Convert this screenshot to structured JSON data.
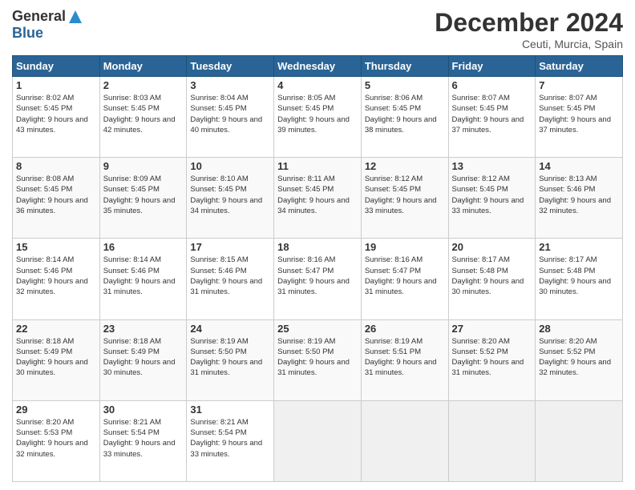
{
  "logo": {
    "general": "General",
    "blue": "Blue"
  },
  "title": "December 2024",
  "location": "Ceuti, Murcia, Spain",
  "days_of_week": [
    "Sunday",
    "Monday",
    "Tuesday",
    "Wednesday",
    "Thursday",
    "Friday",
    "Saturday"
  ],
  "weeks": [
    [
      {
        "day": "1",
        "sunrise": "8:02 AM",
        "sunset": "5:45 PM",
        "daylight": "9 hours and 43 minutes."
      },
      {
        "day": "2",
        "sunrise": "8:03 AM",
        "sunset": "5:45 PM",
        "daylight": "9 hours and 42 minutes."
      },
      {
        "day": "3",
        "sunrise": "8:04 AM",
        "sunset": "5:45 PM",
        "daylight": "9 hours and 40 minutes."
      },
      {
        "day": "4",
        "sunrise": "8:05 AM",
        "sunset": "5:45 PM",
        "daylight": "9 hours and 39 minutes."
      },
      {
        "day": "5",
        "sunrise": "8:06 AM",
        "sunset": "5:45 PM",
        "daylight": "9 hours and 38 minutes."
      },
      {
        "day": "6",
        "sunrise": "8:07 AM",
        "sunset": "5:45 PM",
        "daylight": "9 hours and 37 minutes."
      },
      {
        "day": "7",
        "sunrise": "8:07 AM",
        "sunset": "5:45 PM",
        "daylight": "9 hours and 37 minutes."
      }
    ],
    [
      {
        "day": "8",
        "sunrise": "8:08 AM",
        "sunset": "5:45 PM",
        "daylight": "9 hours and 36 minutes."
      },
      {
        "day": "9",
        "sunrise": "8:09 AM",
        "sunset": "5:45 PM",
        "daylight": "9 hours and 35 minutes."
      },
      {
        "day": "10",
        "sunrise": "8:10 AM",
        "sunset": "5:45 PM",
        "daylight": "9 hours and 34 minutes."
      },
      {
        "day": "11",
        "sunrise": "8:11 AM",
        "sunset": "5:45 PM",
        "daylight": "9 hours and 34 minutes."
      },
      {
        "day": "12",
        "sunrise": "8:12 AM",
        "sunset": "5:45 PM",
        "daylight": "9 hours and 33 minutes."
      },
      {
        "day": "13",
        "sunrise": "8:12 AM",
        "sunset": "5:45 PM",
        "daylight": "9 hours and 33 minutes."
      },
      {
        "day": "14",
        "sunrise": "8:13 AM",
        "sunset": "5:46 PM",
        "daylight": "9 hours and 32 minutes."
      }
    ],
    [
      {
        "day": "15",
        "sunrise": "8:14 AM",
        "sunset": "5:46 PM",
        "daylight": "9 hours and 32 minutes."
      },
      {
        "day": "16",
        "sunrise": "8:14 AM",
        "sunset": "5:46 PM",
        "daylight": "9 hours and 31 minutes."
      },
      {
        "day": "17",
        "sunrise": "8:15 AM",
        "sunset": "5:46 PM",
        "daylight": "9 hours and 31 minutes."
      },
      {
        "day": "18",
        "sunrise": "8:16 AM",
        "sunset": "5:47 PM",
        "daylight": "9 hours and 31 minutes."
      },
      {
        "day": "19",
        "sunrise": "8:16 AM",
        "sunset": "5:47 PM",
        "daylight": "9 hours and 31 minutes."
      },
      {
        "day": "20",
        "sunrise": "8:17 AM",
        "sunset": "5:48 PM",
        "daylight": "9 hours and 30 minutes."
      },
      {
        "day": "21",
        "sunrise": "8:17 AM",
        "sunset": "5:48 PM",
        "daylight": "9 hours and 30 minutes."
      }
    ],
    [
      {
        "day": "22",
        "sunrise": "8:18 AM",
        "sunset": "5:49 PM",
        "daylight": "9 hours and 30 minutes."
      },
      {
        "day": "23",
        "sunrise": "8:18 AM",
        "sunset": "5:49 PM",
        "daylight": "9 hours and 30 minutes."
      },
      {
        "day": "24",
        "sunrise": "8:19 AM",
        "sunset": "5:50 PM",
        "daylight": "9 hours and 31 minutes."
      },
      {
        "day": "25",
        "sunrise": "8:19 AM",
        "sunset": "5:50 PM",
        "daylight": "9 hours and 31 minutes."
      },
      {
        "day": "26",
        "sunrise": "8:19 AM",
        "sunset": "5:51 PM",
        "daylight": "9 hours and 31 minutes."
      },
      {
        "day": "27",
        "sunrise": "8:20 AM",
        "sunset": "5:52 PM",
        "daylight": "9 hours and 31 minutes."
      },
      {
        "day": "28",
        "sunrise": "8:20 AM",
        "sunset": "5:52 PM",
        "daylight": "9 hours and 32 minutes."
      }
    ],
    [
      {
        "day": "29",
        "sunrise": "8:20 AM",
        "sunset": "5:53 PM",
        "daylight": "9 hours and 32 minutes."
      },
      {
        "day": "30",
        "sunrise": "8:21 AM",
        "sunset": "5:54 PM",
        "daylight": "9 hours and 33 minutes."
      },
      {
        "day": "31",
        "sunrise": "8:21 AM",
        "sunset": "5:54 PM",
        "daylight": "9 hours and 33 minutes."
      },
      null,
      null,
      null,
      null
    ]
  ],
  "labels": {
    "sunrise": "Sunrise: ",
    "sunset": "Sunset: ",
    "daylight": "Daylight: "
  }
}
